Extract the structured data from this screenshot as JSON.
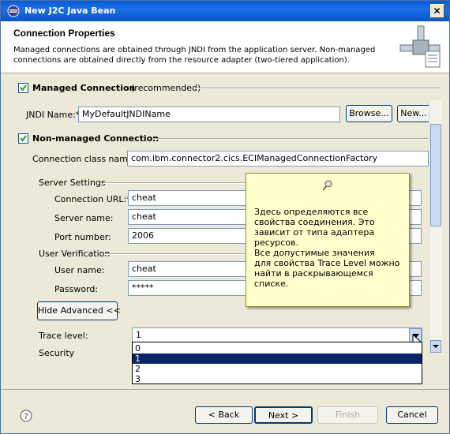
{
  "window": {
    "title": "New J2C Java Bean",
    "close_icon": "close-icon"
  },
  "header": {
    "title": "Connection Properties",
    "description": "Managed connections are obtained through JNDI from the application server.  Non-managed connections are obtained directly from the resource adapter (two-tiered application)."
  },
  "managed": {
    "checkbox_label": "Managed Connection",
    "recommended": "(recommended)",
    "checked": true,
    "jndi_label": "JNDI Name:*",
    "jndi_value": "MyDefaultJNDIName",
    "browse_label": "Browse...",
    "new_label": "New..."
  },
  "nonmanaged": {
    "checkbox_label": "Non-managed Connection",
    "checked": true,
    "class_label": "Connection class name:",
    "class_value": "com.ibm.connector2.cics.ECIManagedConnectionFactory"
  },
  "server_settings": {
    "group_label": "Server Settings",
    "url_label": "Connection URL:*",
    "url_value": "cheat",
    "server_label": "Server name:",
    "server_value": "cheat",
    "port_label": "Port number:",
    "port_value": "2006"
  },
  "user_verification": {
    "group_label": "User Verification",
    "user_label": "User name:",
    "user_value": "cheat",
    "password_label": "Password:",
    "password_value": "*****"
  },
  "advanced": {
    "hide_label": "Hide Advanced <<",
    "trace_label": "Trace level:",
    "trace_value": "1",
    "security_label": "Security",
    "trace_options": [
      "0",
      "1",
      "2",
      "3"
    ],
    "selected_option": "1"
  },
  "tooltip": {
    "text": "Здесь определяются все свойства соединения. Это зависит от типа адаптера ресурсов.\nВсе допустимые  значения\nдля свойства Trace Level можно найти в раскрывающемся списке."
  },
  "footer": {
    "back_label": "< Back",
    "next_label": "Next >",
    "finish_label": "Finish",
    "cancel_label": "Cancel"
  }
}
